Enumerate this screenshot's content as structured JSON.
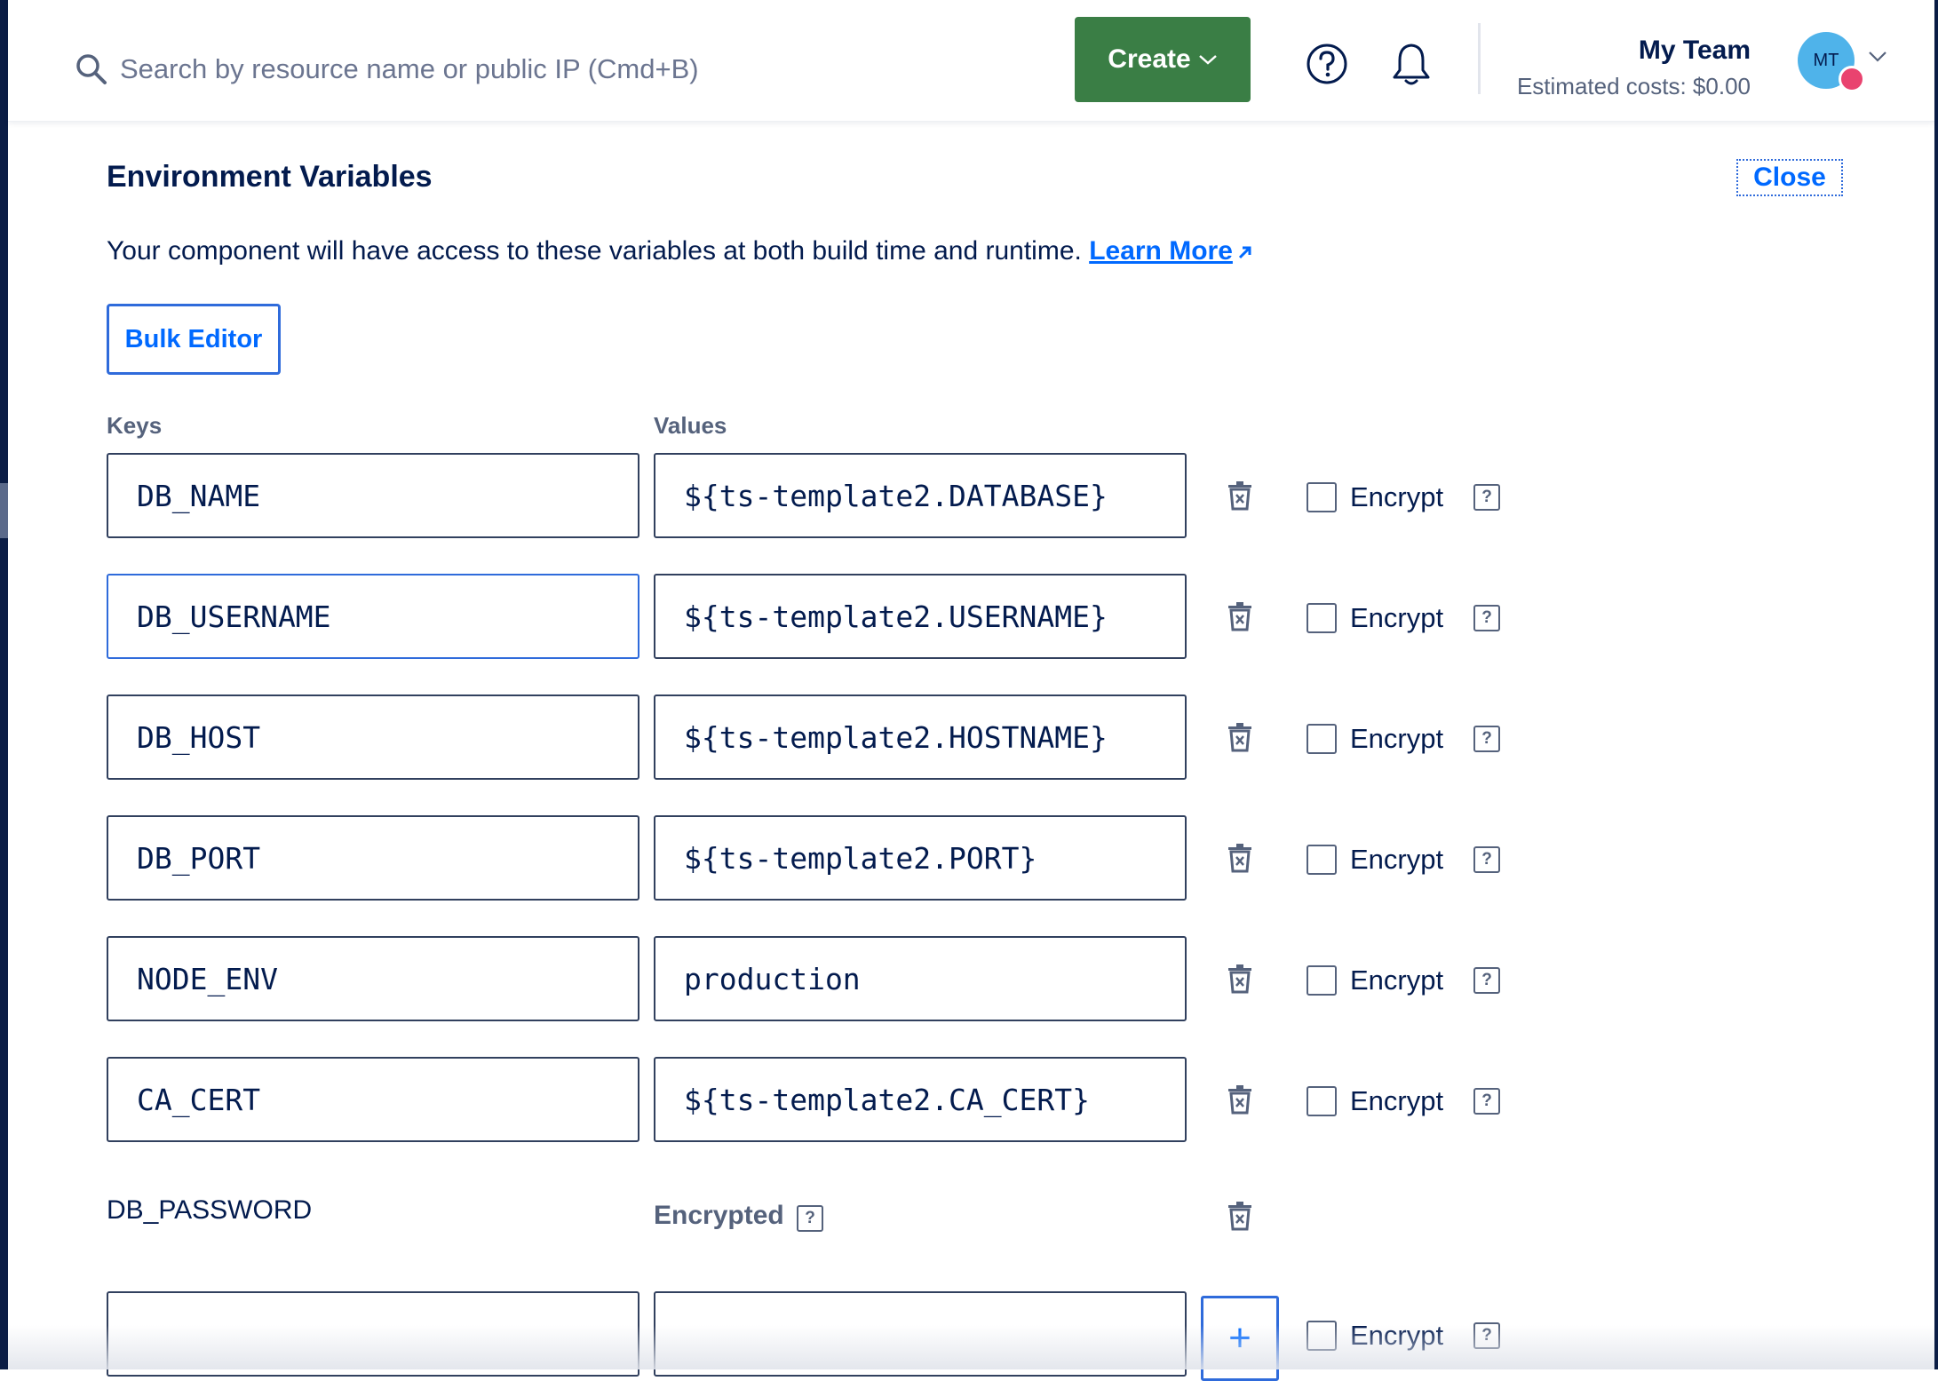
{
  "header": {
    "search_placeholder": "Search by resource name or public IP (Cmd+B)",
    "create_label": "Create",
    "team_name": "My Team",
    "estimated_costs": "Estimated costs: $0.00",
    "avatar_initials": "MT"
  },
  "panel": {
    "title": "Environment Variables",
    "close_label": "Close",
    "description": "Your component will have access to these variables at both build time and runtime.",
    "learn_more": "Learn More",
    "bulk_editor_label": "Bulk Editor",
    "keys_label": "Keys",
    "values_label": "Values",
    "encrypt_label": "Encrypt",
    "help_glyph": "?",
    "rows": [
      {
        "key": "DB_NAME",
        "value": "${ts-template2.DATABASE}"
      },
      {
        "key": "DB_USERNAME",
        "value": "${ts-template2.USERNAME}"
      },
      {
        "key": "DB_HOST",
        "value": "${ts-template2.HOSTNAME}"
      },
      {
        "key": "DB_PORT",
        "value": "${ts-template2.PORT}"
      },
      {
        "key": "NODE_ENV",
        "value": "production"
      },
      {
        "key": "CA_CERT",
        "value": "${ts-template2.CA_CERT}"
      }
    ],
    "encrypted_row": {
      "key": "DB_PASSWORD",
      "status": "Encrypted"
    },
    "new_row": {
      "key": "",
      "value": "",
      "add_glyph": "+"
    }
  },
  "colors": {
    "primary_blue": "#0069ff",
    "create_green": "#3a7e45",
    "text_dark": "#031b4e",
    "text_muted": "#55627c"
  }
}
